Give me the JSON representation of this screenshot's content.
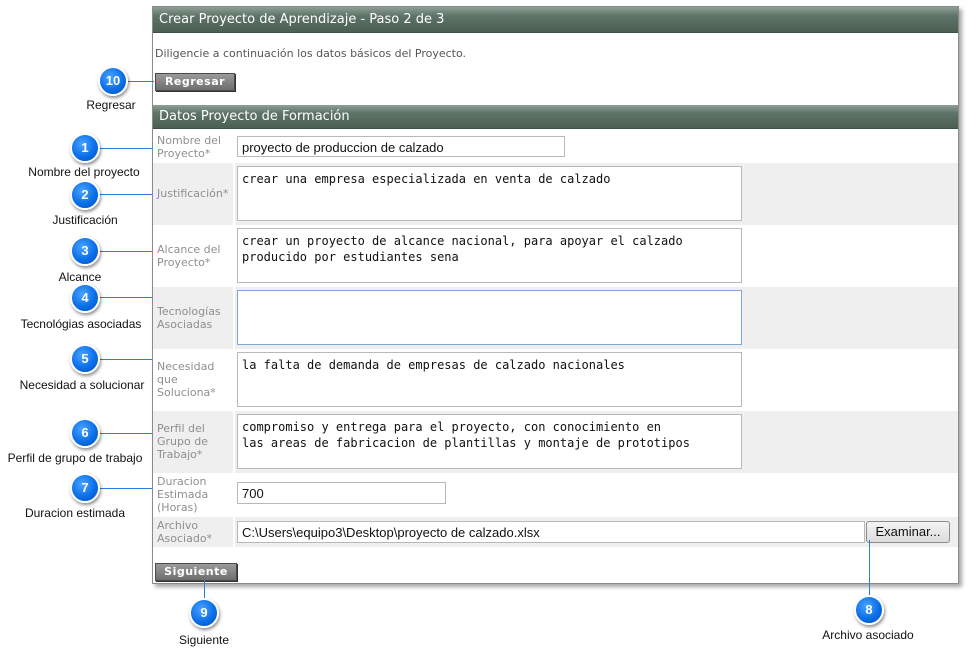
{
  "header": {
    "title": "Crear Proyecto de Aprendizaje - Paso 2 de 3",
    "intro": "Diligencie a continuación los datos básicos del Proyecto.",
    "back_label": "Regresar"
  },
  "section": {
    "title": "Datos Proyecto de Formación"
  },
  "form": {
    "nombre": {
      "label": "Nombre del Proyecto*",
      "value": "proyecto de produccion de calzado"
    },
    "justificacion": {
      "label": "Justificación*",
      "value": "crear una empresa especializada en venta de calzado"
    },
    "alcance": {
      "label": "Alcance del Proyecto*",
      "value": "crear un proyecto de alcance nacional, para apoyar el calzado\nproducido por estudiantes sena"
    },
    "tecnologias": {
      "label": "Tecnologías Asociadas",
      "value": ""
    },
    "necesidad": {
      "label": "Necesidad que Soluciona*",
      "value": "la falta de demanda de empresas de calzado nacionales"
    },
    "perfil": {
      "label": "Perfil del Grupo de Trabajo*",
      "value": "compromiso y entrega para el proyecto, con conocimiento en\nlas areas de fabricacion de plantillas y montaje de prototipos"
    },
    "duracion": {
      "label": "Duracion Estimada (Horas)",
      "value": "700"
    },
    "archivo": {
      "label": "Archivo Asociado*",
      "value": "C:\\Users\\equipo3\\Desktop\\proyecto de calzado.xlsx",
      "browse_label": "Examinar..."
    },
    "next_label": "Siguiente"
  },
  "annotations": [
    {
      "number": "1",
      "caption": "Nombre del proyecto"
    },
    {
      "number": "2",
      "caption": "Justificación"
    },
    {
      "number": "3",
      "caption": "Alcance"
    },
    {
      "number": "4",
      "caption": "Tecnológias asociadas"
    },
    {
      "number": "5",
      "caption": "Necesidad a solucionar"
    },
    {
      "number": "6",
      "caption": "Perfil de grupo de trabajo"
    },
    {
      "number": "7",
      "caption": "Duracion estimada"
    },
    {
      "number": "8",
      "caption": "Archivo asociado"
    },
    {
      "number": "9",
      "caption": "Siguiente"
    },
    {
      "number": "10",
      "caption": "Regresar"
    }
  ],
  "colors": {
    "header_bg": "#4b5f53",
    "marker": "#0a6fe8",
    "row_alt": "#efefef"
  }
}
